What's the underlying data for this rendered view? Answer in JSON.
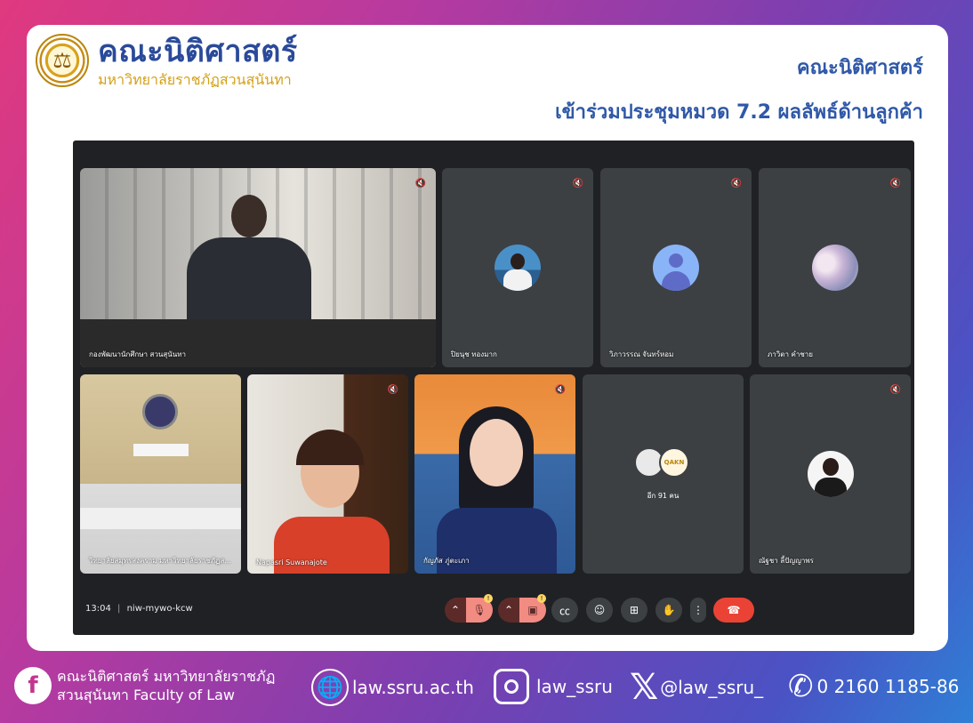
{
  "header": {
    "logo_title": "คณะนิติศาสตร์",
    "logo_subtitle": "มหาวิทยาลัยราชภัฏสวนสุนันทา",
    "title": "คณะนิติศาสตร์",
    "subtitle": "เข้าร่วมประชุมหมวด 7.2 ผลลัพธ์ด้านลูกค้า"
  },
  "meeting": {
    "time": "13:04",
    "separator": "|",
    "code": "niw-mywo-kcw",
    "participants": [
      {
        "name": "กองพัฒนานักศึกษา สวนสุนันทา",
        "muted": true,
        "type": "video"
      },
      {
        "name": "ปิยนุช ทองมาก",
        "muted": true,
        "type": "avatar-photo"
      },
      {
        "name": "วิภาวรรณ จันทร์หอม",
        "muted": true,
        "type": "avatar-default"
      },
      {
        "name": "ภาวิตา คำชาย",
        "muted": true,
        "type": "avatar-sky"
      },
      {
        "name": "วิทยาลัยสมุทรสงคราม มหาวิทยาลัยราชภัฏส...",
        "muted": false,
        "type": "video"
      },
      {
        "name": "Napasri Suwanajote",
        "muted": true,
        "type": "video"
      },
      {
        "name": "กัญภัส ภู่ตะเภา",
        "muted": true,
        "type": "video"
      },
      {
        "name": "อีก 91 คน",
        "muted": false,
        "type": "others"
      },
      {
        "name": "ณัฐชา ลี้ปัญญาพร",
        "muted": true,
        "type": "avatar-photo"
      }
    ],
    "others_badge": "QAKN"
  },
  "footer": {
    "facebook_line1": "คณะนิติศาสตร์ มหาวิทยาลัยราชภัฏ",
    "facebook_line2": "สวนสุนันทา Faculty of Law",
    "website": "law.ssru.ac.th",
    "instagram": "law_ssru",
    "x_handle": "@law_ssru_",
    "phone": "0 2160 1185-86"
  },
  "colors": {
    "brand_blue": "#2f58a8",
    "gold": "#d4a017",
    "meet_bg": "#202124",
    "tile_bg": "#3c4043",
    "end_call": "#ea4335"
  }
}
